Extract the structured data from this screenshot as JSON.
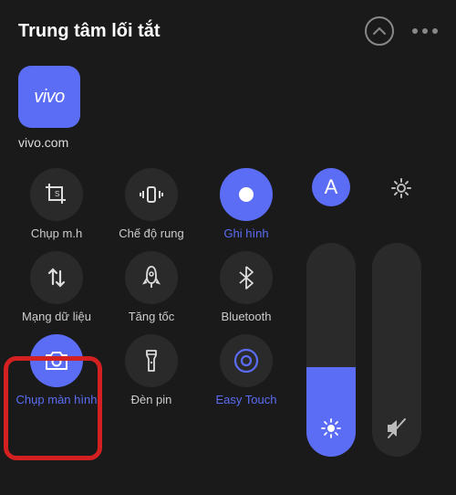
{
  "header": {
    "title": "Trung tâm lối tắt"
  },
  "app": {
    "brand": "vivo",
    "label": "vivo.com"
  },
  "shortcuts": {
    "screenshot_crop": "Chụp m.h",
    "vibrate": "Chế độ rung",
    "record": "Ghi hình",
    "mobile_data": "Mạng dữ liệu",
    "boost": "Tăng tốc",
    "bluetooth": "Bluetooth",
    "screenshot": "Chụp màn hình",
    "flashlight": "Đèn pin",
    "easy_touch": "Easy Touch"
  },
  "auto_brightness_label": "A"
}
